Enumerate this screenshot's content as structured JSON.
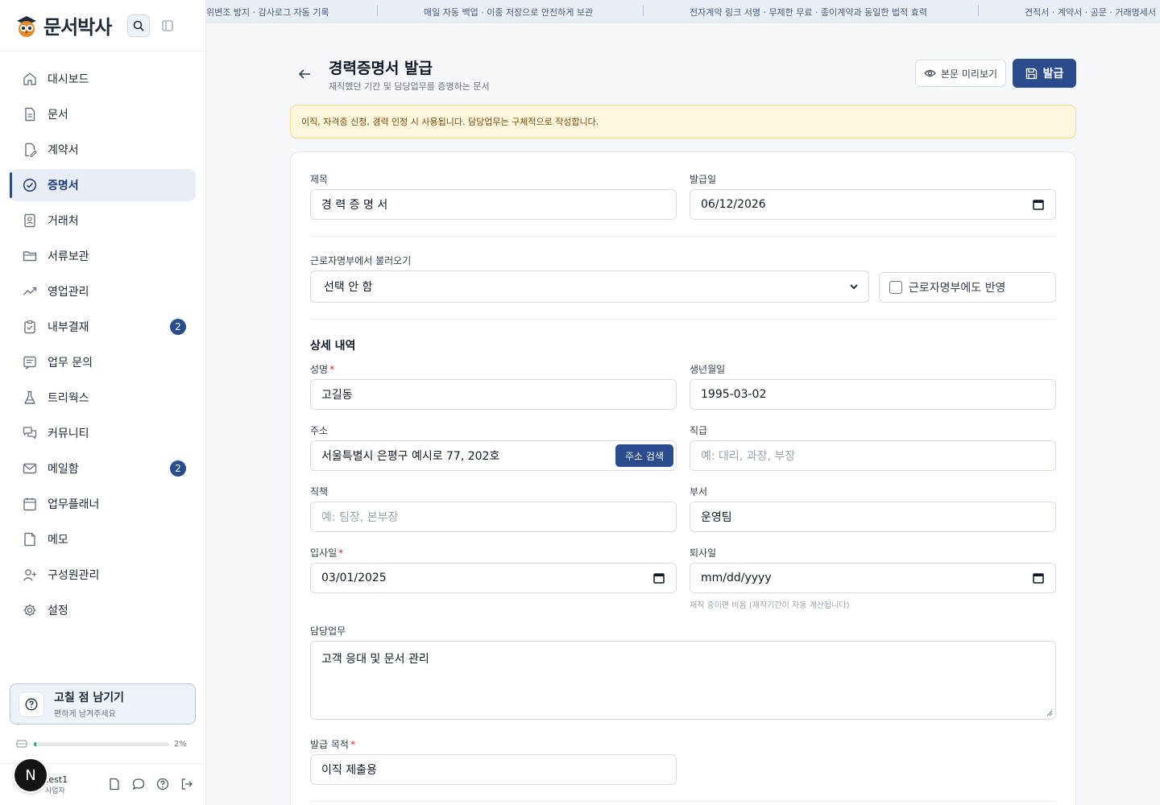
{
  "app": {
    "name": "문서박사"
  },
  "ticker": {
    "items": [
      "위변조 방지 · 감사로그 자동 기록",
      "매일 자동 백업 · 이중 저장으로 안전하게 보관",
      "전자계약 링크 서명 · 무제한 무료 · 종이계약과 동일한 법적 효력",
      "견적서 · 계약서 · 공문 · 거래명세서"
    ]
  },
  "sidebar": {
    "items": [
      {
        "label": "대시보드",
        "icon": "home-icon"
      },
      {
        "label": "문서",
        "icon": "document-icon"
      },
      {
        "label": "계약서",
        "icon": "contract-icon"
      },
      {
        "label": "증명서",
        "icon": "certificate-icon",
        "active": true
      },
      {
        "label": "거래처",
        "icon": "client-icon"
      },
      {
        "label": "서류보관",
        "icon": "folder-icon"
      },
      {
        "label": "영업관리",
        "icon": "trend-icon"
      },
      {
        "label": "내부결재",
        "icon": "clipboard-icon",
        "badge": "2"
      },
      {
        "label": "업무 문의",
        "icon": "inquiry-icon"
      },
      {
        "label": "트리웍스",
        "icon": "flask-icon"
      },
      {
        "label": "커뮤니티",
        "icon": "chat-icon"
      },
      {
        "label": "메일함",
        "icon": "mail-icon",
        "badge": "2"
      },
      {
        "label": "업무플래너",
        "icon": "calendar-icon"
      },
      {
        "label": "메모",
        "icon": "memo-icon"
      },
      {
        "label": "구성원관리",
        "icon": "user-add-icon"
      },
      {
        "label": "설정",
        "icon": "gear-icon"
      }
    ],
    "feedback": {
      "title": "고칠 점 남기기",
      "subtitle": "편하게 남겨주세요"
    },
    "storage": {
      "percent_label": "2%",
      "percent": 0.02
    },
    "user": {
      "name": "test1",
      "role": "사업자",
      "avatar_letter": "N"
    }
  },
  "header": {
    "title": "경력증명서 발급",
    "subtitle": "재직했던 기간 및 담당업무를 증명하는 문서",
    "preview_label": "본문 미리보기",
    "issue_label": "발급"
  },
  "notice": "이직, 자격증 신청, 경력 인정 시 사용됩니다. 담당업무는 구체적으로 작성합니다.",
  "form": {
    "title_label": "제목",
    "title_value": "경 력 증 명 서",
    "issue_date_label": "발급일",
    "issue_date_value": "06/12/2026",
    "import_label": "근로자명부에서 불러오기",
    "import_value": "선택 안 함",
    "reflect_label": "근로자명부에도 반영",
    "detail_title": "상세 내역",
    "name_label": "성명",
    "name_value": "고길동",
    "birth_label": "생년월일",
    "birth_value": "1995-03-02",
    "address_label": "주소",
    "address_value": "서울특별시 은평구 예시로 77, 202호",
    "address_search": "주소 검색",
    "rank_label": "직급",
    "rank_placeholder": "예: 대리, 과장, 부장",
    "position_label": "직책",
    "position_placeholder": "예: 팀장, 본부장",
    "dept_label": "부서",
    "dept_value": "운영팀",
    "join_label": "입사일",
    "join_value": "03/01/2025",
    "leave_label": "퇴사일",
    "leave_placeholder": "mm/dd/yyyy",
    "leave_hint": "재직 중이면 비움 (재직기간이 자동 계산됩니다)",
    "duty_label": "담당업무",
    "duty_value": "고객 응대 및 문서 관리",
    "purpose_label": "발급 목적",
    "purpose_value": "이직 제출용",
    "required_mark": "*"
  },
  "colors": {
    "primary": "#2b4c8c",
    "notice_bg": "#fdf6dc",
    "required": "#dc2626"
  }
}
